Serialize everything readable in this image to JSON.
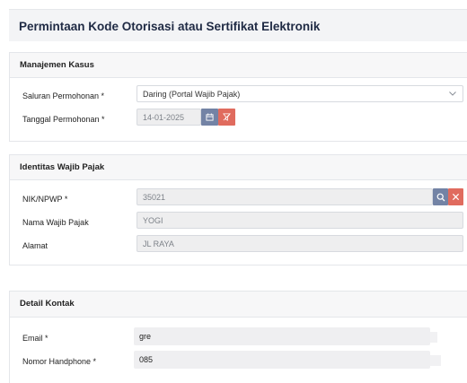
{
  "page": {
    "title": "Permintaan Kode Otorisasi atau Sertifikat Elektronik"
  },
  "case_management": {
    "title": "Manajemen Kasus",
    "channel_label": "Saluran Permohonan *",
    "channel_value": "Daring (Portal Wajib Pajak)",
    "date_label": "Tanggal Permohonan *",
    "date_value": "14-01-2025"
  },
  "taxpayer_identity": {
    "title": "Identitas Wajib Pajak",
    "nik_label": "NIK/NPWP *",
    "nik_value": "35021",
    "name_label": "Nama Wajib Pajak",
    "name_value": "YOGI",
    "address_label": "Alamat",
    "address_value": "JL RAYA"
  },
  "contact_details": {
    "title": "Detail Kontak",
    "email_label": "Email  *",
    "email_value": "gre",
    "phone_label": "Nomor Handphone  *",
    "phone_value": "085"
  },
  "colors": {
    "primary_button": "#7383a5",
    "danger_button": "#e06b5e",
    "title": "#1f2a44"
  },
  "icons": [
    "chevron-down-icon",
    "calendar-icon",
    "filter-clear-icon",
    "search-icon",
    "close-icon"
  ]
}
